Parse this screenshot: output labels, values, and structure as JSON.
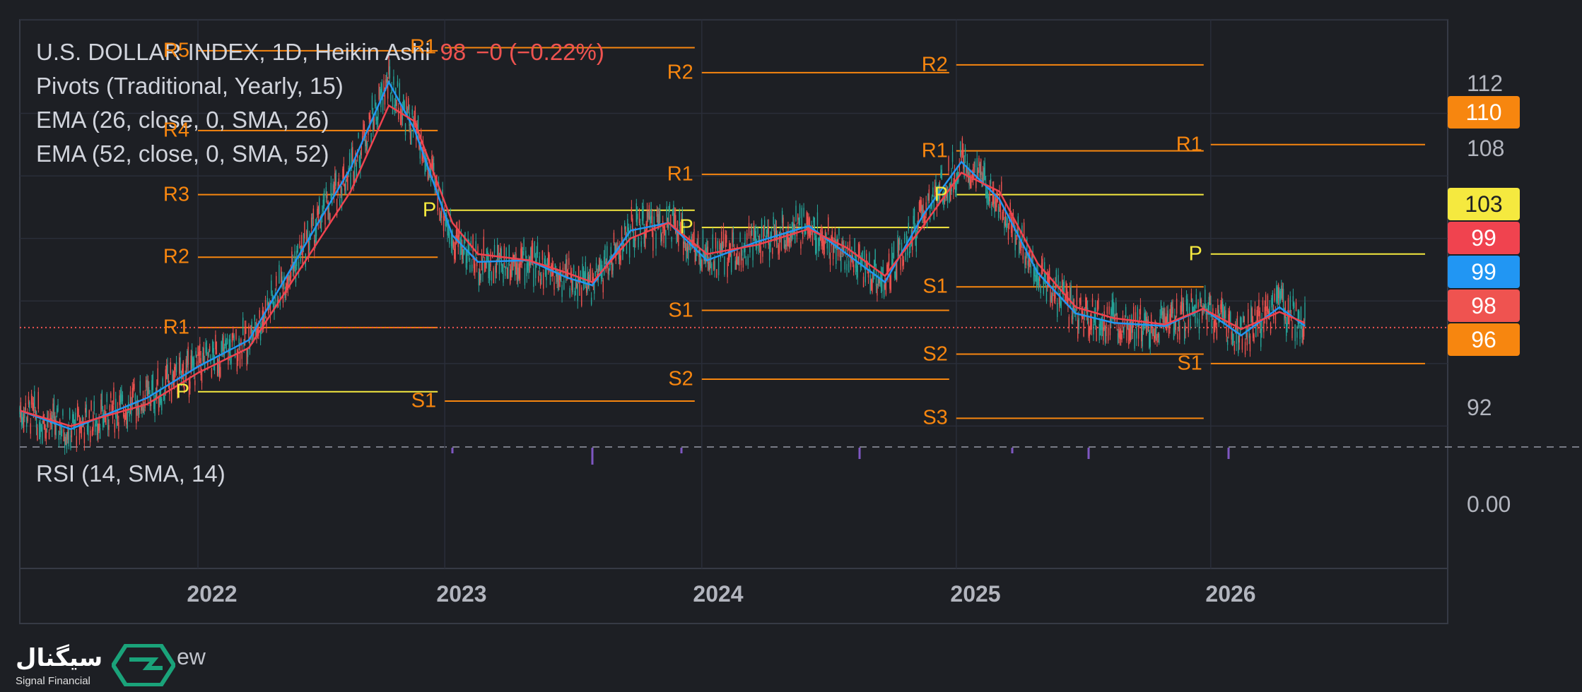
{
  "header": {
    "symbol": "U.S. DOLLAR INDEX, 1D, Heikin Ashi",
    "price": "98",
    "change": "−0 (−0.22%)",
    "indicators": [
      "Pivots (Traditional, Yearly, 15)",
      "EMA (26, close, 0, SMA, 26)",
      "EMA (52, close, 0, SMA, 52)"
    ]
  },
  "rsi_label": "RSI (14, SMA, 14)",
  "rsi_value_label": "0.00",
  "price_labels": [
    "112",
    "108",
    "92"
  ],
  "badges": [
    {
      "text": "110",
      "color": "#f7860f",
      "text_color": "#ffffff"
    },
    {
      "text": "103",
      "color": "#f5e93f",
      "text_color": "#1d1f24"
    },
    {
      "text": "99",
      "color": "#f0434f",
      "text_color": "#ffffff"
    },
    {
      "text": "99",
      "color": "#2196f3",
      "text_color": "#ffffff"
    },
    {
      "text": "98",
      "color": "#ef5350",
      "text_color": "#ffffff"
    },
    {
      "text": "96",
      "color": "#f7860f",
      "text_color": "#ffffff"
    }
  ],
  "years": [
    "2022",
    "2023",
    "2024",
    "2025",
    "2026"
  ],
  "colors": {
    "background": "#1d1f24",
    "pivot_level": "#f7860f",
    "pivot_p": "#f5e93f",
    "ema26": "#2196f3",
    "ema52": "#f0434f",
    "candle_up": "#26a69a",
    "candle_down": "#ef5350",
    "rsi": "#7e57c2"
  },
  "logo": {
    "name": "سیگنال",
    "subtitle": "Signal Financial",
    "fragment": "ew"
  },
  "chart_data": {
    "type": "line",
    "title": "U.S. DOLLAR INDEX, 1D, Heikin Ashi",
    "ylim": [
      88,
      118
    ],
    "y_ticks": [
      92,
      108,
      112
    ],
    "x_ticks": [
      "2022",
      "2023",
      "2024",
      "2025",
      "2026"
    ],
    "series": [
      {
        "name": "EMA (26, close, 0, SMA, 26)",
        "color": "#2196f3",
        "x": [
          2021.3,
          2021.5,
          2021.8,
          2022.0,
          2022.2,
          2022.4,
          2022.6,
          2022.75,
          2022.85,
          2023.0,
          2023.1,
          2023.3,
          2023.45,
          2023.55,
          2023.7,
          2023.85,
          2024.0,
          2024.2,
          2024.4,
          2024.55,
          2024.7,
          2024.85,
          2025.0,
          2025.15,
          2025.3,
          2025.45,
          2025.6,
          2025.8,
          2025.95,
          2026.1,
          2026.25,
          2026.35
        ],
        "values": [
          93.0,
          91.8,
          93.8,
          95.8,
          97.5,
          103.0,
          108.5,
          114.0,
          111.0,
          104.2,
          102.5,
          102.6,
          101.5,
          101.0,
          104.5,
          105.0,
          102.6,
          103.8,
          104.8,
          103.0,
          101.2,
          105.5,
          108.9,
          106.5,
          101.8,
          99.2,
          98.6,
          98.4,
          99.5,
          97.8,
          99.6,
          98.4
        ]
      },
      {
        "name": "EMA (52, close, 0, SMA, 52)",
        "color": "#f0434f",
        "x": [
          2021.3,
          2021.5,
          2021.8,
          2022.0,
          2022.2,
          2022.4,
          2022.6,
          2022.75,
          2022.85,
          2023.0,
          2023.1,
          2023.3,
          2023.45,
          2023.55,
          2023.7,
          2023.85,
          2024.0,
          2024.2,
          2024.4,
          2024.55,
          2024.7,
          2024.85,
          2025.0,
          2025.15,
          2025.3,
          2025.45,
          2025.6,
          2025.8,
          2025.95,
          2026.1,
          2026.25,
          2026.35
        ],
        "values": [
          93.0,
          92.0,
          93.4,
          95.4,
          97.0,
          102.0,
          107.0,
          112.5,
          111.5,
          105.0,
          103.0,
          102.6,
          101.8,
          101.2,
          104.0,
          105.0,
          103.0,
          103.6,
          104.6,
          103.4,
          101.6,
          104.8,
          108.2,
          107.0,
          102.4,
          99.6,
          98.9,
          98.5,
          99.5,
          98.2,
          99.3,
          98.6
        ]
      },
      {
        "name": "RSI (14, SMA, 14)",
        "color": "#7e57c2",
        "x": [
          2021.3,
          2022.0,
          2022.85,
          2023.0,
          2023.55,
          2023.9,
          2024.6,
          2025.2,
          2025.5,
          2026.05,
          2026.35
        ],
        "values": [
          0,
          0,
          0,
          -1,
          -3,
          -1,
          -2,
          -1,
          -2,
          -2,
          0
        ]
      }
    ],
    "pivot_levels": [
      {
        "period": "2022",
        "x_range": [
          2022.0,
          2022.97
        ],
        "levels": [
          {
            "label": "R5",
            "value": 116.0
          },
          {
            "label": "R4",
            "value": 110.9
          },
          {
            "label": "R3",
            "value": 106.8
          },
          {
            "label": "R2",
            "value": 102.8
          },
          {
            "label": "R1",
            "value": 98.3
          },
          {
            "label": "P",
            "value": 94.2
          }
        ]
      },
      {
        "period": "2023",
        "x_range": [
          2022.97,
          2023.98
        ],
        "levels": [
          {
            "label": "R1",
            "value": 116.2
          },
          {
            "label": "P",
            "value": 105.8
          },
          {
            "label": "S1",
            "value": 93.6
          }
        ]
      },
      {
        "period": "2024",
        "x_range": [
          2023.98,
          2024.98
        ],
        "levels": [
          {
            "label": "R2",
            "value": 114.6
          },
          {
            "label": "R1",
            "value": 108.1
          },
          {
            "label": "P",
            "value": 104.7
          },
          {
            "label": "S1",
            "value": 99.4
          },
          {
            "label": "S2",
            "value": 95.0
          }
        ]
      },
      {
        "period": "2025",
        "x_range": [
          2024.98,
          2025.98
        ],
        "levels": [
          {
            "label": "R2",
            "value": 115.1
          },
          {
            "label": "R1",
            "value": 109.6
          },
          {
            "label": "P",
            "value": 106.8
          },
          {
            "label": "S1",
            "value": 100.9
          },
          {
            "label": "S2",
            "value": 96.6
          },
          {
            "label": "S3",
            "value": 92.5
          }
        ]
      },
      {
        "period": "2026",
        "x_range": [
          2025.98,
          2026.85
        ],
        "levels": [
          {
            "label": "R1",
            "value": 110.0
          },
          {
            "label": "P",
            "value": 103.0
          },
          {
            "label": "S1",
            "value": 96.0
          }
        ]
      }
    ],
    "current_price": 98.3
  }
}
